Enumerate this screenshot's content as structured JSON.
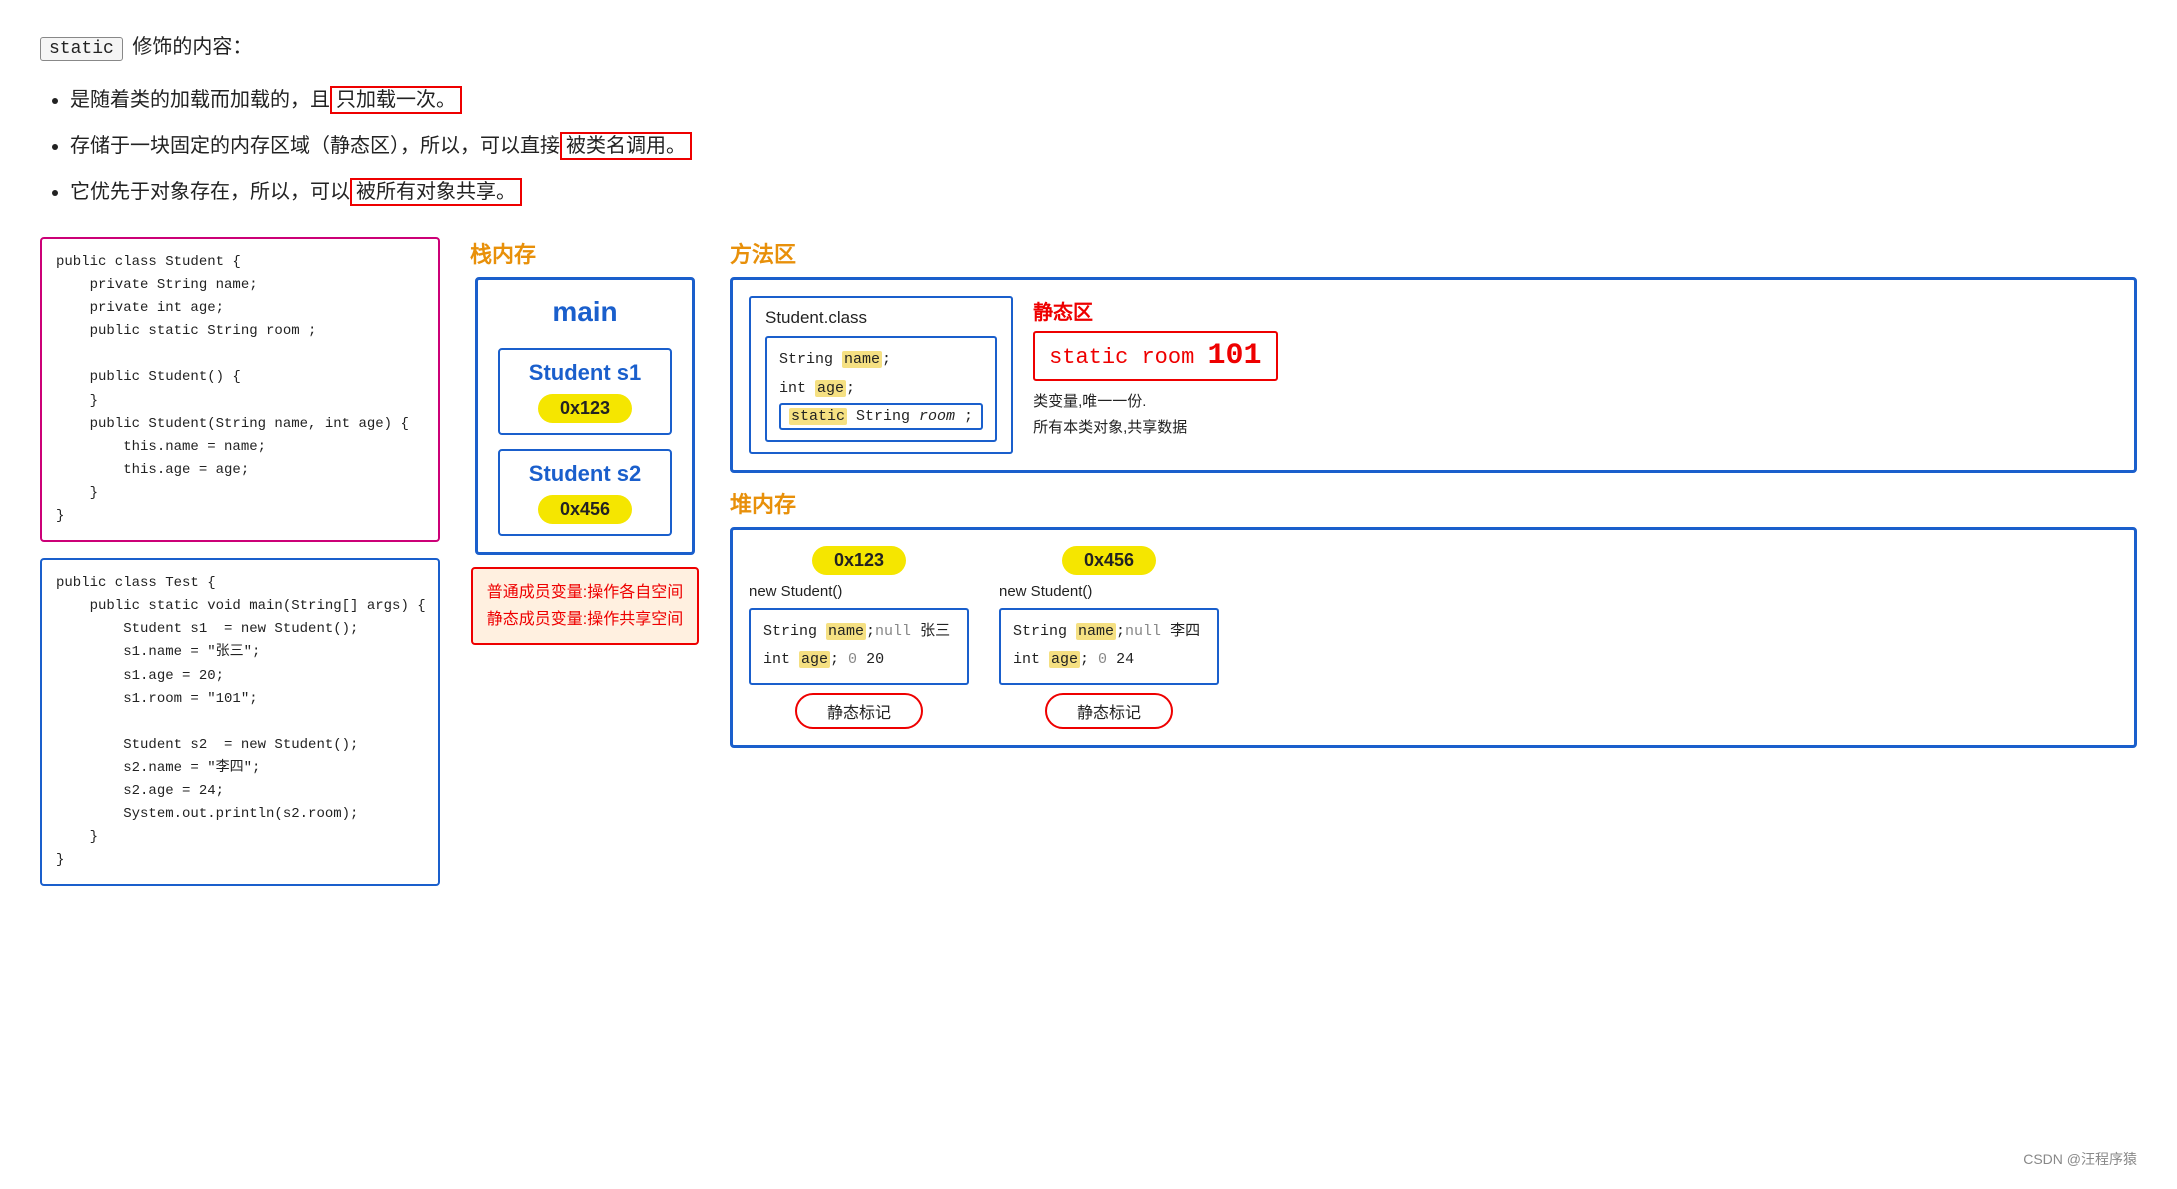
{
  "header": {
    "title": "static 修饰的内容："
  },
  "static_keyword": "static",
  "bullets": [
    {
      "text_before": "是随着类的加载而加载的，且",
      "highlighted": "只加载一次。",
      "text_after": ""
    },
    {
      "text_before": "存储于一块固定的内存区域（静态区），所以，可以直接被类名调用。",
      "highlighted": "可以直接被类名调用。",
      "text_after": ""
    },
    {
      "text_before": "它优先于对象存在，所以，可以",
      "highlighted": "被所有对象共享。",
      "text_after": ""
    }
  ],
  "code_panel1": {
    "content": "public class Student {\n    private String name;\n    private int age;\n    public static String room ;\n\n    public Student() {\n    }\n    public Student(String name, int age) {\n        this.name = name;\n        this.age = age;\n    }\n}"
  },
  "code_panel2": {
    "content": "public class Test {\n    public static void main(String[] args) {\n        Student s1  = new Student();\n        s1.name = \"张三\";\n        s1.age = 20;\n        s1.room = \"101\";\n\n        Student s2  = new Student();\n        s2.name = \"李四\";\n        s2.age = 24;\n        System.out.println(s2.room);\n    }\n}"
  },
  "stack_section": {
    "title": "栈内存",
    "main_label": "main",
    "s1_label": "Student s1",
    "s1_addr": "0x123",
    "s2_label": "Student s2",
    "s2_addr": "0x456"
  },
  "method_section": {
    "title": "方法区",
    "student_class_title": "Student.class",
    "fields": {
      "name": "String name;",
      "age": "int age;",
      "static_field": "static String room ;"
    },
    "static_zone": {
      "title": "静态区",
      "room_label": "static room",
      "room_value": "101",
      "desc1": "类变量,唯一一份.",
      "desc2": "所有本类对象,共享数据"
    }
  },
  "heap_section": {
    "title": "堆内存",
    "objects": [
      {
        "addr": "0x123",
        "new_label": "new Student()",
        "name_field": "String name; null 张三",
        "age_field": "int age;    0   20",
        "static_tag": "静态标记"
      },
      {
        "addr": "0x456",
        "new_label": "new Student()",
        "name_field": "String name; null 李四",
        "age_field": "int age;    0   24",
        "static_tag": "静态标记"
      }
    ]
  },
  "note_box": {
    "line1": "普通成员变量:操作各自空间",
    "line2": "静态成员变量:操作共享空间"
  },
  "footer": {
    "text": "CSDN @汪程序猿"
  }
}
